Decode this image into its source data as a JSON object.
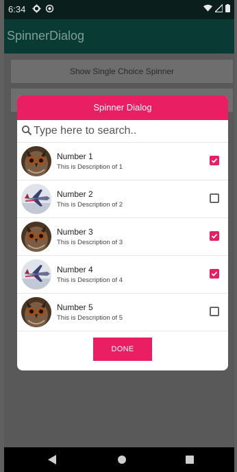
{
  "status_bar": {
    "time": "6:34",
    "icons": [
      "settings-icon",
      "sync-icon",
      "wifi-icon",
      "signal-icon",
      "battery-icon"
    ]
  },
  "app_bar": {
    "title": "SpinnerDialog"
  },
  "background_buttons": {
    "single_choice_label": "Show Single Choice Spinner"
  },
  "dialog": {
    "title": "Spinner Dialog",
    "search_placeholder": "Type here to search..",
    "items": [
      {
        "name": "Number 1",
        "description": "This is Description of 1",
        "avatar": "owl-image",
        "checked": true
      },
      {
        "name": "Number 2",
        "description": "This is Description of 2",
        "avatar": "jet-image",
        "checked": false
      },
      {
        "name": "Number 3",
        "description": "This is Description of 3",
        "avatar": "owl-image",
        "checked": true
      },
      {
        "name": "Number 4",
        "description": "This is Description of 4",
        "avatar": "jet-image",
        "checked": true
      },
      {
        "name": "Number 5",
        "description": "This is Description of 5",
        "avatar": "owl-image",
        "checked": false
      }
    ],
    "done_label": "DONE"
  },
  "colors": {
    "accent": "#e91e63",
    "app_bar": "#093a33",
    "status_bar": "#0a1f1b"
  }
}
